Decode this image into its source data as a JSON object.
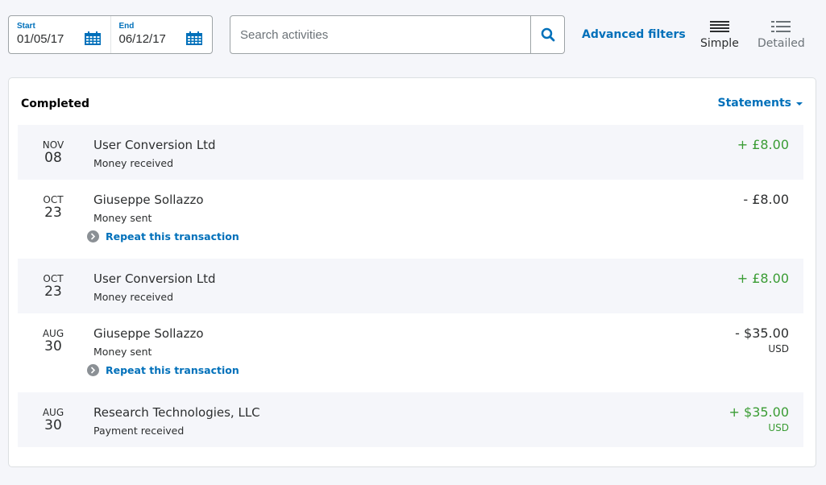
{
  "date_range": {
    "start_label": "Start",
    "start_value": "01/05/17",
    "end_label": "End",
    "end_value": "06/12/17"
  },
  "search": {
    "placeholder": "Search activities",
    "value": ""
  },
  "advanced_filters_label": "Advanced filters",
  "view_modes": {
    "simple_label": "Simple",
    "detailed_label": "Detailed",
    "selected": "Simple"
  },
  "card": {
    "title": "Completed",
    "statements_label": "Statements"
  },
  "transactions": [
    {
      "month": "NOV",
      "day": "08",
      "name": "User Conversion Ltd",
      "type": "Money received",
      "amount": "+ £8.00",
      "currency": "",
      "direction": "in",
      "repeat_label": ""
    },
    {
      "month": "OCT",
      "day": "23",
      "name": "Giuseppe Sollazzo",
      "type": "Money sent",
      "amount": "- £8.00",
      "currency": "",
      "direction": "out",
      "repeat_label": "Repeat this transaction"
    },
    {
      "month": "OCT",
      "day": "23",
      "name": "User Conversion Ltd",
      "type": "Money received",
      "amount": "+ £8.00",
      "currency": "",
      "direction": "in",
      "repeat_label": ""
    },
    {
      "month": "AUG",
      "day": "30",
      "name": "Giuseppe Sollazzo",
      "type": "Money sent",
      "amount": "- $35.00",
      "currency": "USD",
      "direction": "out",
      "repeat_label": "Repeat this transaction"
    },
    {
      "month": "AUG",
      "day": "30",
      "name": "Research Technologies, LLC",
      "type": "Payment received",
      "amount": "+ $35.00",
      "currency": "USD",
      "direction": "in",
      "repeat_label": ""
    }
  ],
  "colors": {
    "accent": "#0070ba",
    "positive": "#3a9c34",
    "text": "#2c2e2f"
  }
}
